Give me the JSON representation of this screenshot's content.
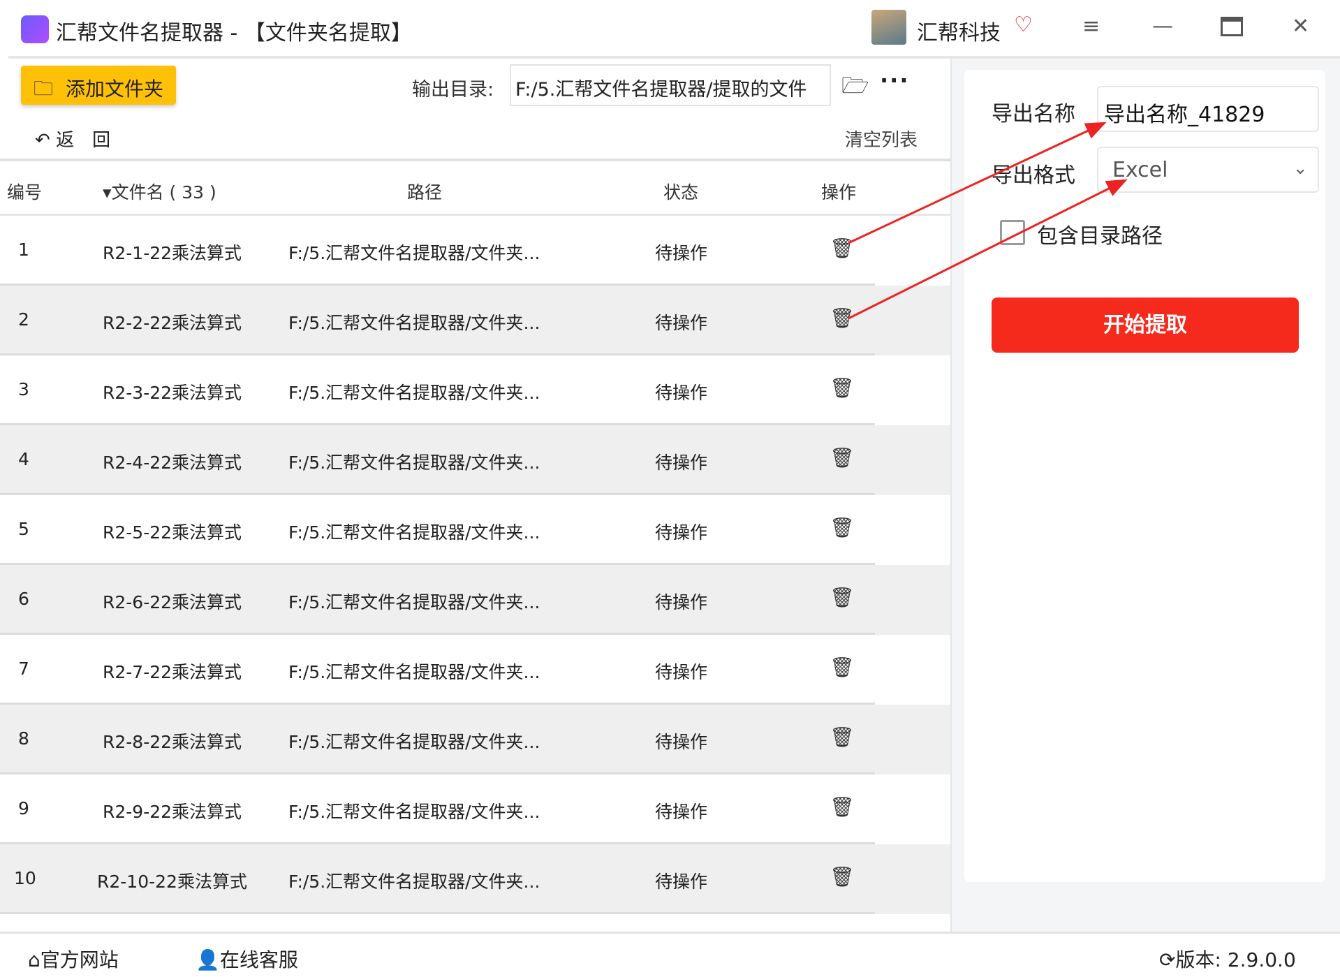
{
  "titlebar": {
    "title": "汇帮文件名提取器 - 【文件夹名提取】",
    "brand": "汇帮科技"
  },
  "toolbar": {
    "add_folder": "添加文件夹",
    "output_label": "输出目录:",
    "output_value": "F:/5.汇帮文件名提取器/提取的文件",
    "back": "返　回",
    "clear": "清空列表"
  },
  "table": {
    "headers": {
      "num": "编号",
      "name": "文件名 ( 33 )",
      "path": "路径",
      "status": "状态",
      "op": "操作"
    },
    "rows": [
      {
        "num": "1",
        "name": "R2-1-22乘法算式",
        "path": "F:/5.汇帮文件名提取器/文件夹...",
        "status": "待操作"
      },
      {
        "num": "2",
        "name": "R2-2-22乘法算式",
        "path": "F:/5.汇帮文件名提取器/文件夹...",
        "status": "待操作"
      },
      {
        "num": "3",
        "name": "R2-3-22乘法算式",
        "path": "F:/5.汇帮文件名提取器/文件夹...",
        "status": "待操作"
      },
      {
        "num": "4",
        "name": "R2-4-22乘法算式",
        "path": "F:/5.汇帮文件名提取器/文件夹...",
        "status": "待操作"
      },
      {
        "num": "5",
        "name": "R2-5-22乘法算式",
        "path": "F:/5.汇帮文件名提取器/文件夹...",
        "status": "待操作"
      },
      {
        "num": "6",
        "name": "R2-6-22乘法算式",
        "path": "F:/5.汇帮文件名提取器/文件夹...",
        "status": "待操作"
      },
      {
        "num": "7",
        "name": "R2-7-22乘法算式",
        "path": "F:/5.汇帮文件名提取器/文件夹...",
        "status": "待操作"
      },
      {
        "num": "8",
        "name": "R2-8-22乘法算式",
        "path": "F:/5.汇帮文件名提取器/文件夹...",
        "status": "待操作"
      },
      {
        "num": "9",
        "name": "R2-9-22乘法算式",
        "path": "F:/5.汇帮文件名提取器/文件夹...",
        "status": "待操作"
      },
      {
        "num": "10",
        "name": "R2-10-22乘法算式",
        "path": "F:/5.汇帮文件名提取器/文件夹...",
        "status": "待操作"
      }
    ]
  },
  "settings": {
    "name_label": "导出名称",
    "name_value": "导出名称_41829",
    "format_label": "导出格式",
    "format_value": "Excel",
    "include_path": "包含目录路径",
    "include_path_checked": false,
    "start": "开始提取"
  },
  "footer": {
    "website": "官方网站",
    "support": "在线客服",
    "version": "版本:  2.9.0.0"
  },
  "colors": {
    "accent_yellow": "#ffc107",
    "start_red": "#f52a1c",
    "annotation": "#ee2222"
  }
}
